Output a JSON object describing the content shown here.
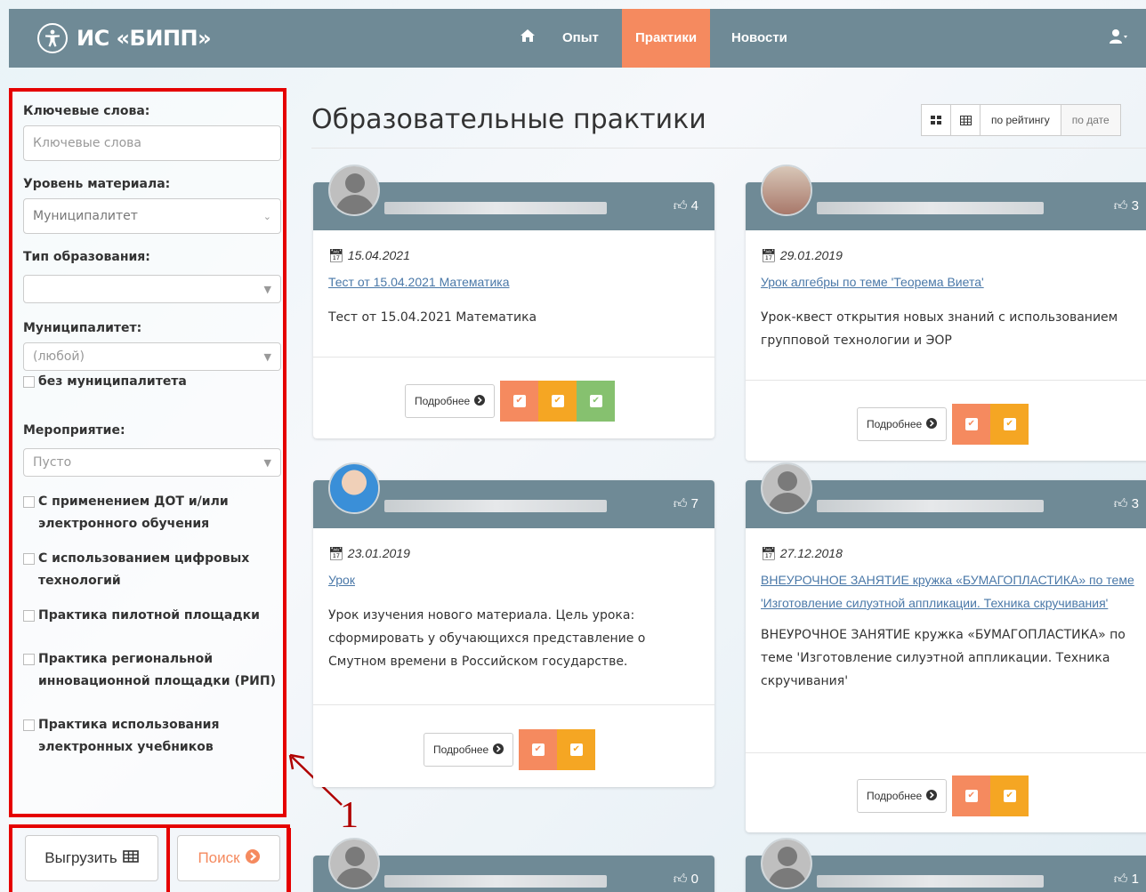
{
  "header": {
    "brand": "ИС «БИПП»",
    "nav": [
      {
        "label": "Опыт"
      },
      {
        "label": "Практики",
        "active": true
      },
      {
        "label": "Новости"
      }
    ],
    "colors": {
      "bar": "#6f8a96",
      "active": "#f58a5f"
    }
  },
  "filters": {
    "keywords_label": "Ключевые слова:",
    "keywords_placeholder": "Ключевые слова",
    "level_label": "Уровень материала:",
    "level_value": "Муниципалитет",
    "edu_type_label": "Тип образования:",
    "edu_type_value": "",
    "municipality_label": "Муниципалитет:",
    "municipality_value": "(любой)",
    "no_municipality": "без муниципалитета",
    "event_label": "Мероприятие:",
    "event_value": "Пусто",
    "checkboxes": [
      "С применением ДОТ и/или электронного обучения",
      "С использованием цифровых технологий",
      "Практика пилотной площадки",
      "Практика региональной инновационной площадки (РИП)",
      "Практика использования электронных учебников"
    ]
  },
  "actions": {
    "export_label": "Выгрузить",
    "search_label": "Поиск"
  },
  "annotation": {
    "number": "1"
  },
  "main": {
    "title": "Образовательные практики",
    "sort_rating": "по рейтингу",
    "sort_date": "по дате",
    "more_label": "Подробнее",
    "cards": [
      {
        "likes": "4",
        "date": "15.04.2021",
        "title": "Тест от 15.04.2021 Математика",
        "desc": "Тест от 15.04.2021 Математика"
      },
      {
        "likes": "3",
        "date": "29.01.2019",
        "title": "Урок алгебры по теме 'Теорема Виета'",
        "desc": "Урок-квест открытия новых знаний с использованием групповой технологии и ЭОР"
      },
      {
        "likes": "7",
        "date": "23.01.2019",
        "title": "Урок",
        "desc": "Урок изучения нового материала. Цель урока: сформировать у обучающихся представление о Смутном времени в Российском государстве."
      },
      {
        "likes": "3",
        "date": "27.12.2018",
        "title": "ВНЕУРОЧНОЕ ЗАНЯТИЕ кружка «БУМАГОПЛАСТИКА» по теме 'Изготовление силуэтной аппликации. Техника скручивания'",
        "desc": "ВНЕУРОЧНОЕ ЗАНЯТИЕ кружка «БУМАГОПЛАСТИКА» по теме 'Изготовление силуэтной аппликации. Техника скручивания'"
      },
      {
        "likes": "0"
      },
      {
        "likes": "1"
      }
    ]
  }
}
